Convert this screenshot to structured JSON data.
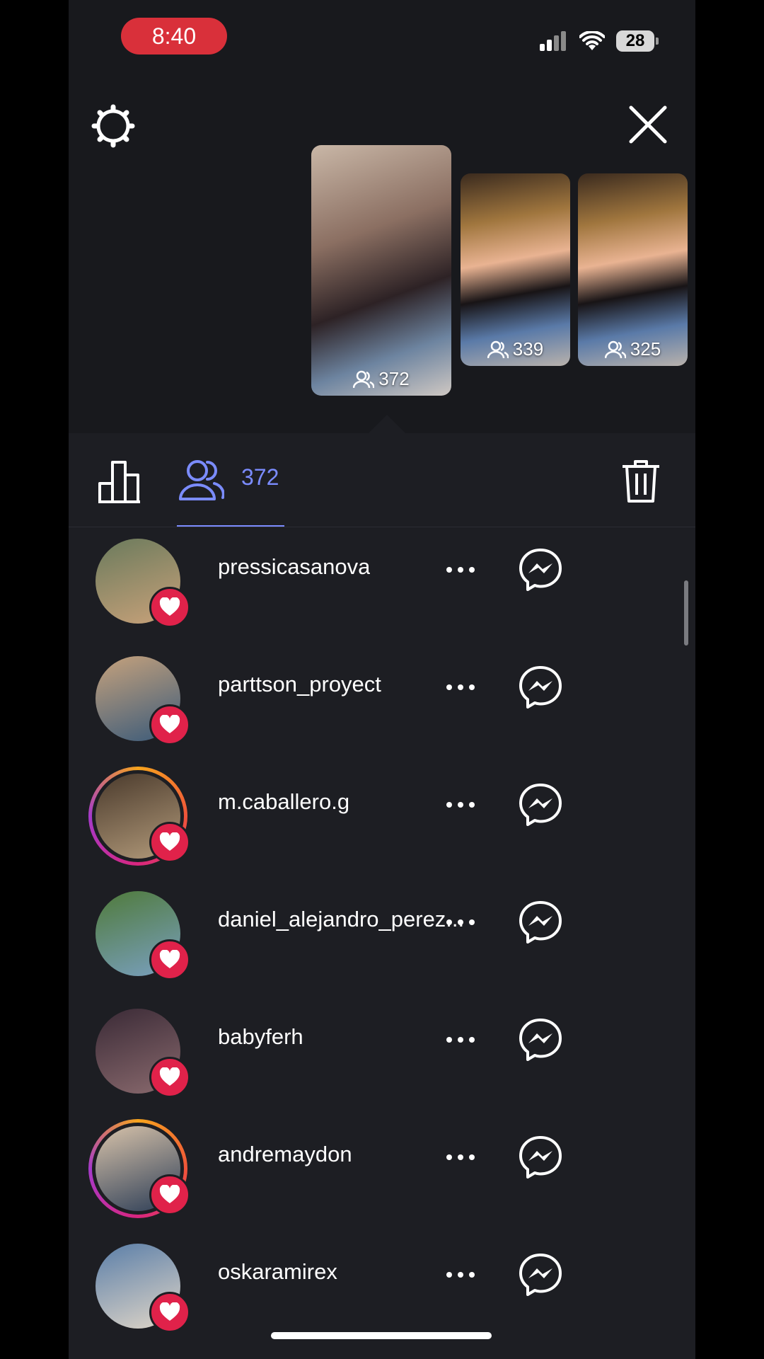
{
  "status_bar": {
    "time": "8:40",
    "battery": "28"
  },
  "stories": [
    {
      "viewers": "372"
    },
    {
      "viewers": "339"
    },
    {
      "viewers": "325"
    }
  ],
  "tabs": {
    "viewer_count": "372"
  },
  "viewers": [
    {
      "username": "pressicasanova",
      "ring": false
    },
    {
      "username": "parttson_proyect",
      "ring": false
    },
    {
      "username": "m.caballero.g",
      "ring": true
    },
    {
      "username": "daniel_alejandro_perez...",
      "ring": false
    },
    {
      "username": "babyferh",
      "ring": false
    },
    {
      "username": "andremaydon",
      "ring": true
    },
    {
      "username": "oskaramirex",
      "ring": false
    }
  ],
  "colors": {
    "accent": "#7b8cff",
    "heart": "#e0224a",
    "status_time_bg": "#d9303a"
  }
}
